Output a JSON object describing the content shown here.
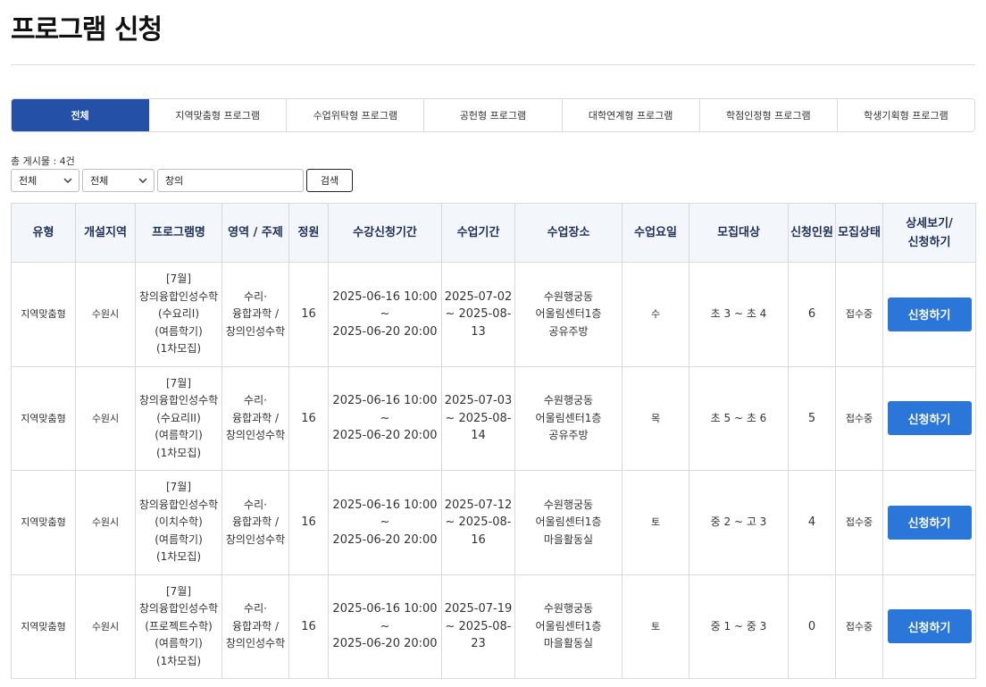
{
  "page": {
    "title": "프로그램 신청"
  },
  "tabs": [
    {
      "label": "전체",
      "active": true
    },
    {
      "label": "지역맞춤형 프로그램",
      "active": false
    },
    {
      "label": "수업위탁형 프로그램",
      "active": false
    },
    {
      "label": "공헌형 프로그램",
      "active": false
    },
    {
      "label": "대학연계형 프로그램",
      "active": false
    },
    {
      "label": "학점인정형 프로그램",
      "active": false
    },
    {
      "label": "학생기획형 프로그램",
      "active": false
    }
  ],
  "total": {
    "label": "총 게시물 : 4건"
  },
  "filters": {
    "select1": "전체",
    "select2": "전체",
    "search_value": "창의",
    "search_button": "검색"
  },
  "table": {
    "headers": [
      "유형",
      "개설지역",
      "프로그램명",
      "영역 / 주제",
      "정원",
      "수강신청기간",
      "수업기간",
      "수업장소",
      "수업요일",
      "모집대상",
      "신청인원",
      "모집상태",
      "상세보기/",
      "신청하기"
    ],
    "rows": [
      {
        "type": "지역맞춤형",
        "region": "수원시",
        "name": [
          "[7월]",
          "창의융합인성수학",
          "(수요리I)",
          "(여름학기)",
          "(1차모집)"
        ],
        "area": [
          "수리·",
          "융합과학 /",
          "창의인성수학"
        ],
        "capacity": "16",
        "apply_period": [
          "2025-06-16 10:00 ~",
          "2025-06-20 20:00"
        ],
        "class_period": [
          "2025-07-02",
          "~ 2025-08-",
          "13"
        ],
        "place": [
          "수원행궁동",
          "어울림센터1층",
          "공유주방"
        ],
        "day": "수",
        "target": "초 3 ~ 초 4",
        "applicants": "6",
        "status": "접수중",
        "action": "신청하기"
      },
      {
        "type": "지역맞춤형",
        "region": "수원시",
        "name": [
          "[7월]",
          "창의융합인성수학",
          "(수요리II)",
          "(여름학기)",
          "(1차모집)"
        ],
        "area": [
          "수리·",
          "융합과학 /",
          "창의인성수학"
        ],
        "capacity": "16",
        "apply_period": [
          "2025-06-16 10:00 ~",
          "2025-06-20 20:00"
        ],
        "class_period": [
          "2025-07-03",
          "~ 2025-08-",
          "14"
        ],
        "place": [
          "수원행궁동",
          "어울림센터1층",
          "공유주방"
        ],
        "day": "목",
        "target": "초 5 ~ 초 6",
        "applicants": "5",
        "status": "접수중",
        "action": "신청하기"
      },
      {
        "type": "지역맞춤형",
        "region": "수원시",
        "name": [
          "[7월]",
          "창의융합인성수학",
          "(이치수학)",
          "(여름학기)",
          "(1차모집)"
        ],
        "area": [
          "수리·",
          "융합과학 /",
          "창의인성수학"
        ],
        "capacity": "16",
        "apply_period": [
          "2025-06-16 10:00 ~",
          "2025-06-20 20:00"
        ],
        "class_period": [
          "2025-07-12",
          "~ 2025-08-",
          "16"
        ],
        "place": [
          "수원행궁동",
          "어울림센터1층",
          "마을활동실"
        ],
        "day": "토",
        "target": "중 2 ~ 고 3",
        "applicants": "4",
        "status": "접수중",
        "action": "신청하기"
      },
      {
        "type": "지역맞춤형",
        "region": "수원시",
        "name": [
          "[7월]",
          "창의융합인성수학",
          "(프로젝트수학)",
          "(여름학기)",
          "(1차모집)"
        ],
        "area": [
          "수리·",
          "융합과학 /",
          "창의인성수학"
        ],
        "capacity": "16",
        "apply_period": [
          "2025-06-16 10:00 ~",
          "2025-06-20 20:00"
        ],
        "class_period": [
          "2025-07-19",
          "~ 2025-08-",
          "23"
        ],
        "place": [
          "수원행궁동",
          "어울림센터1층",
          "마을활동실"
        ],
        "day": "토",
        "target": "중 1 ~ 중 3",
        "applicants": "0",
        "status": "접수중",
        "action": "신청하기"
      }
    ]
  }
}
